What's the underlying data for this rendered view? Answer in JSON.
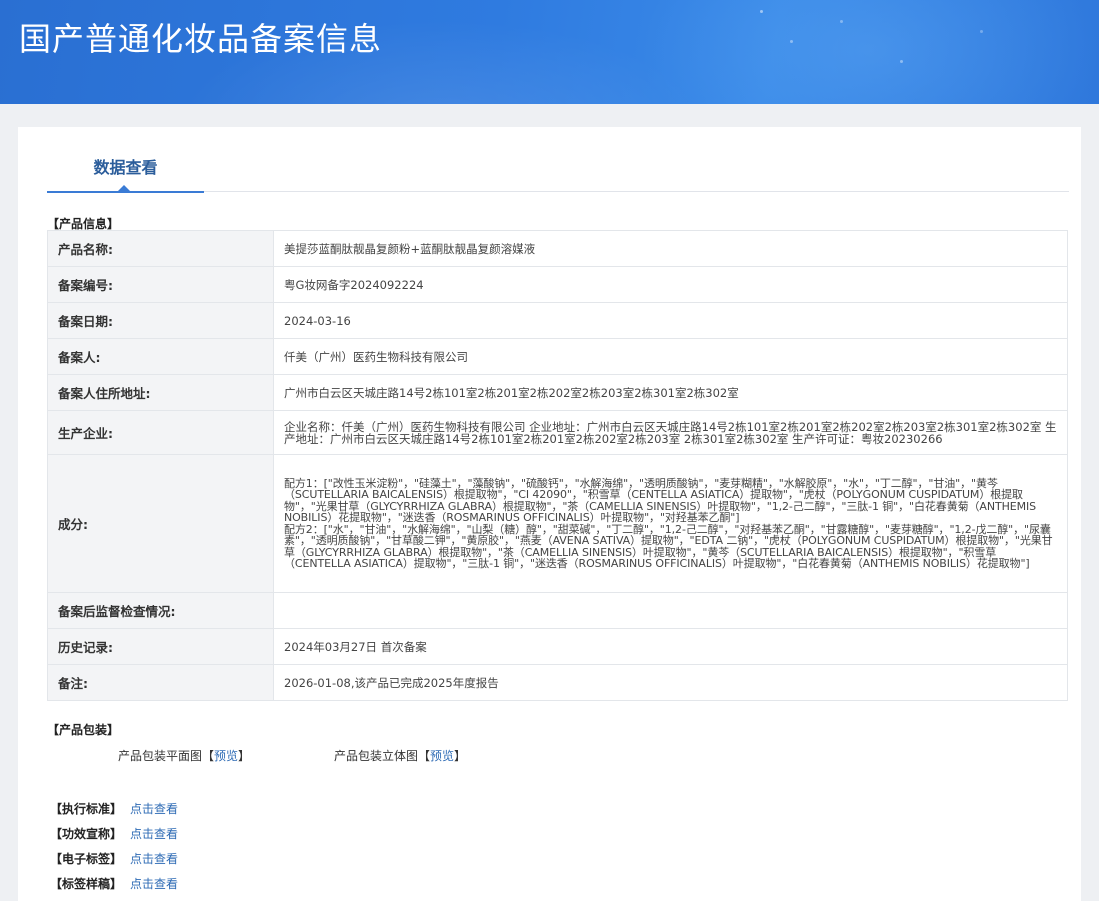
{
  "page": {
    "title": "国产普通化妆品备案信息"
  },
  "tabs": [
    {
      "label": "数据查看"
    }
  ],
  "product_info": {
    "section_title": "【产品信息】",
    "rows": [
      {
        "label": "产品名称:",
        "value": "美提莎蓝酮肽靓晶复颜粉+蓝酮肽靓晶复颜溶媒液"
      },
      {
        "label": "备案编号:",
        "value": "粤G妆网备字2024092224"
      },
      {
        "label": "备案日期:",
        "value": "2024-03-16"
      },
      {
        "label": "备案人:",
        "value": "仟美（广州）医药生物科技有限公司"
      },
      {
        "label": "备案人住所地址:",
        "value": "广州市白云区天城庄路14号2栋101室2栋201室2栋202室2栋203室2栋301室2栋302室"
      },
      {
        "label": "生产企业:",
        "value": "企业名称：仟美（广州）医药生物科技有限公司 企业地址：广州市白云区天城庄路14号2栋101室2栋201室2栋202室2栋203室2栋301室2栋302室 生产地址：广州市白云区天城庄路14号2栋101室2栋201室2栋202室2栋203室 2栋301室2栋302室 生产许可证：粤妆20230266"
      },
      {
        "label": "成分:",
        "value": "配方1：[\"改性玉米淀粉\"，\"硅藻土\"，\"藻酸钠\"，\"硫酸钙\"，\"水解海绵\"，\"透明质酸钠\"，\"麦芽糊精\"，\"水解胶原\"，\"水\"，\"丁二醇\"，\"甘油\"，\"黄芩（SCUTELLARIA BAICALENSIS）根提取物\"，\"CI 42090\"，\"积雪草（CENTELLA ASIATICA）提取物\"，\"虎杖（POLYGONUM CUSPIDATUM）根提取物\"，\"光果甘草（GLYCYRRHIZA GLABRA）根提取物\"，\"茶（CAMELLIA SINENSIS）叶提取物\"，\"1,2-己二醇\"，\"三肽-1 铜\"，\"白花春黄菊（ANTHEMIS NOBILIS）花提取物\"，\"迷迭香（ROSMARINUS OFFICINALIS）叶提取物\"，\"对羟基苯乙酮\"]\n配方2：[\"水\"，\"甘油\"，\"水解海绵\"，\"山梨（糖）醇\"，\"甜菜碱\"，\"丁二醇\"，\"1,2-己二醇\"，\"对羟基苯乙酮\"，\"甘露糖醇\"，\"麦芽糖醇\"，\"1,2-戊二醇\"，\"尿囊素\"，\"透明质酸钠\"，\"甘草酸二钾\"，\"黄原胶\"，\"燕麦（AVENA SATIVA）提取物\"，\"EDTA 二钠\"，\"虎杖（POLYGONUM CUSPIDATUM）根提取物\"，\"光果甘草（GLYCYRRHIZA GLABRA）根提取物\"，\"茶（CAMELLIA SINENSIS）叶提取物\"，\"黄芩（SCUTELLARIA BAICALENSIS）根提取物\"，\"积雪草（CENTELLA ASIATICA）提取物\"，\"三肽-1 铜\"，\"迷迭香（ROSMARINUS OFFICINALIS）叶提取物\"，\"白花春黄菊（ANTHEMIS NOBILIS）花提取物\"]"
      },
      {
        "label": "备案后监督检查情况:",
        "value": ""
      },
      {
        "label": "历史记录:",
        "value": "2024年03月27日 首次备案"
      },
      {
        "label": "备注:",
        "value": "2026-01-08,该产品已完成2025年度报告"
      }
    ]
  },
  "packaging": {
    "section_title": "【产品包装】",
    "flat": {
      "label": "产品包装平面图",
      "bracket_open": "【",
      "link": "预览",
      "bracket_close": "】"
    },
    "solid": {
      "label": "产品包装立体图",
      "bracket_open": "【",
      "link": "预览",
      "bracket_close": "】"
    }
  },
  "standards": [
    {
      "label": "【执行标准】",
      "link": "点击查看"
    },
    {
      "label": "【功效宣称】",
      "link": "点击查看"
    },
    {
      "label": "【电子标签】",
      "link": "点击查看"
    },
    {
      "label": "【标签样稿】",
      "link": "点击查看"
    }
  ]
}
